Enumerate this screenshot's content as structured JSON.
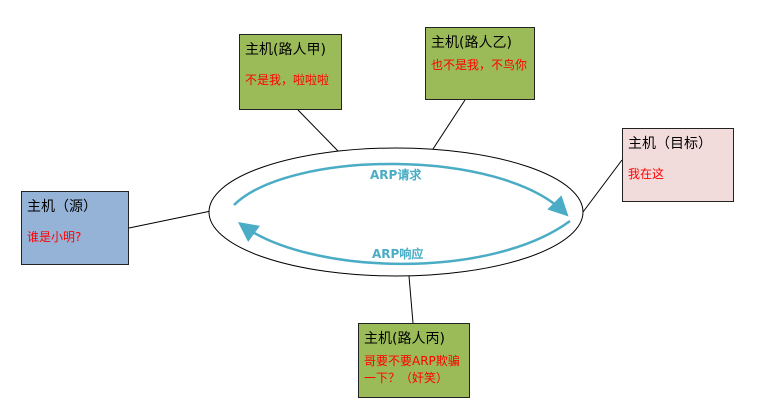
{
  "colors": {
    "source_fill": "#95b3d7",
    "passer_fill": "#9bbb59",
    "target_fill": "#f2dcdb",
    "arrow": "#4aacc5",
    "message_text": "#ff0000"
  },
  "nodes": {
    "source": {
      "title": "主机（源）",
      "message": "谁是小明?"
    },
    "passer_a": {
      "title": "主机(路人甲)",
      "message": "不是我，啦啦啦"
    },
    "passer_b": {
      "title": "主机(路人乙)",
      "message": "也不是我，不鸟你"
    },
    "target": {
      "title": "主机（目标）",
      "message": "我在这"
    },
    "passer_c": {
      "title": "主机(路人丙)",
      "message": "哥要不要ARP欺骗一下？（奸笑）"
    }
  },
  "network": {
    "request_label": "ARP请求",
    "reply_label": "ARP响应"
  }
}
